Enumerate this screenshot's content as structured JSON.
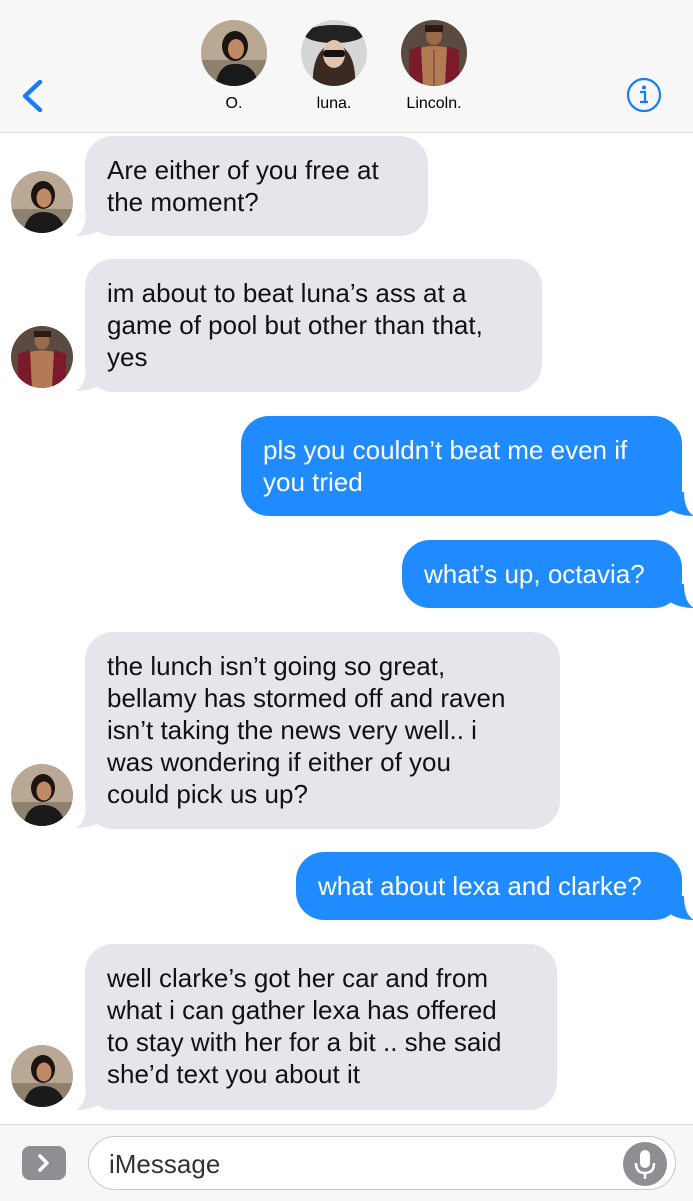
{
  "header": {
    "participants": [
      {
        "name": "O.",
        "avatar": "avatar-o"
      },
      {
        "name": "luna.",
        "avatar": "avatar-luna"
      },
      {
        "name": "Lincoln.",
        "avatar": "avatar-lincoln"
      }
    ],
    "back_icon": "chevron-left-icon",
    "info_icon": "info-icon"
  },
  "messages": [
    {
      "direction": "received",
      "sender": "O.",
      "lines": [
        "Are either of you free at",
        "the moment?"
      ]
    },
    {
      "direction": "received",
      "sender": "Lincoln.",
      "lines": [
        "im about to beat luna’s ass at a",
        "game of pool but other than that,",
        "yes"
      ]
    },
    {
      "direction": "sent",
      "lines": [
        "pls you couldn’t beat me even if",
        "you tried"
      ]
    },
    {
      "direction": "sent",
      "lines": [
        "what’s up, octavia?"
      ]
    },
    {
      "direction": "received",
      "sender": "O.",
      "lines": [
        "the lunch isn’t going so great,",
        "bellamy has stormed off and raven",
        "isn’t taking the news very well.. i",
        "was wondering if either of you",
        "could pick us up?"
      ]
    },
    {
      "direction": "sent",
      "lines": [
        "what about lexa and clarke?"
      ]
    },
    {
      "direction": "received",
      "sender": "O.",
      "lines": [
        "well clarke’s got her car and from",
        "what i can gather lexa has offered",
        "to stay with her for a bit .. she said",
        "she’d text you about it"
      ]
    }
  ],
  "input": {
    "placeholder": "iMessage",
    "apps_icon": "chevron-right-icon",
    "mic_icon": "microphone-icon"
  },
  "colors": {
    "sent_bubble": "#1f8bff",
    "received_bubble": "#e6e5eb",
    "accent": "#1a7cf5"
  }
}
